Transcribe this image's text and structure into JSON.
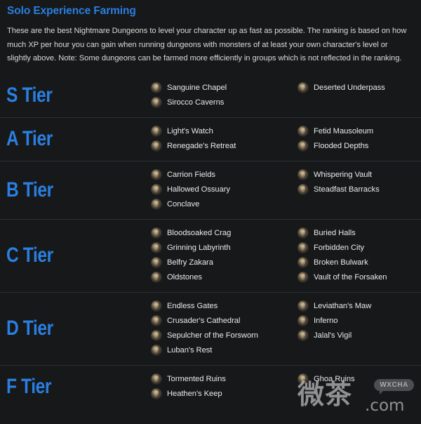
{
  "page": {
    "title": "Solo Experience Farming",
    "intro": "These are the best Nightmare Dungeons to level your character up as fast as possible. The ranking is based on how much XP per hour you can gain when running dungeons with monsters of at least your own character's level or slightly above. Note: Some dungeons can be farmed more efficiently in groups which is not reflected in the ranking.",
    "accent_color": "#2a7fe0",
    "background_color": "#16181a",
    "text_color": "#e7e9ea"
  },
  "tiers": [
    {
      "label": "S Tier",
      "columns": [
        [
          "Sanguine Chapel",
          "Sirocco Caverns"
        ],
        [
          "Deserted Underpass"
        ]
      ]
    },
    {
      "label": "A Tier",
      "columns": [
        [
          "Light's Watch",
          "Renegade's Retreat"
        ],
        [
          "Fetid Mausoleum",
          "Flooded Depths"
        ]
      ]
    },
    {
      "label": "B Tier",
      "columns": [
        [
          "Carrion Fields",
          "Hallowed Ossuary",
          "Conclave"
        ],
        [
          "Whispering Vault",
          "Steadfast Barracks"
        ]
      ]
    },
    {
      "label": "C Tier",
      "columns": [
        [
          "Bloodsoaked Crag",
          "Grinning Labyrinth",
          "Belfry Zakara",
          "Oldstones"
        ],
        [
          "Buried Halls",
          "Forbidden City",
          "Broken Bulwark",
          "Vault of the Forsaken"
        ]
      ]
    },
    {
      "label": "D Tier",
      "columns": [
        [
          "Endless Gates",
          "Crusader's Cathedral",
          "Sepulcher of the Forsworn",
          "Luban's Rest"
        ],
        [
          "Leviathan's Maw",
          "Inferno",
          "Jalal's Vigil"
        ]
      ]
    },
    {
      "label": "F Tier",
      "columns": [
        [
          "Tormented Ruins",
          "Heathen's Keep"
        ],
        [
          "Ghoa Ruins"
        ]
      ]
    }
  ],
  "watermark": {
    "brand_cn": "微茶",
    "domain": ".com",
    "bubble": "WXCHA"
  }
}
